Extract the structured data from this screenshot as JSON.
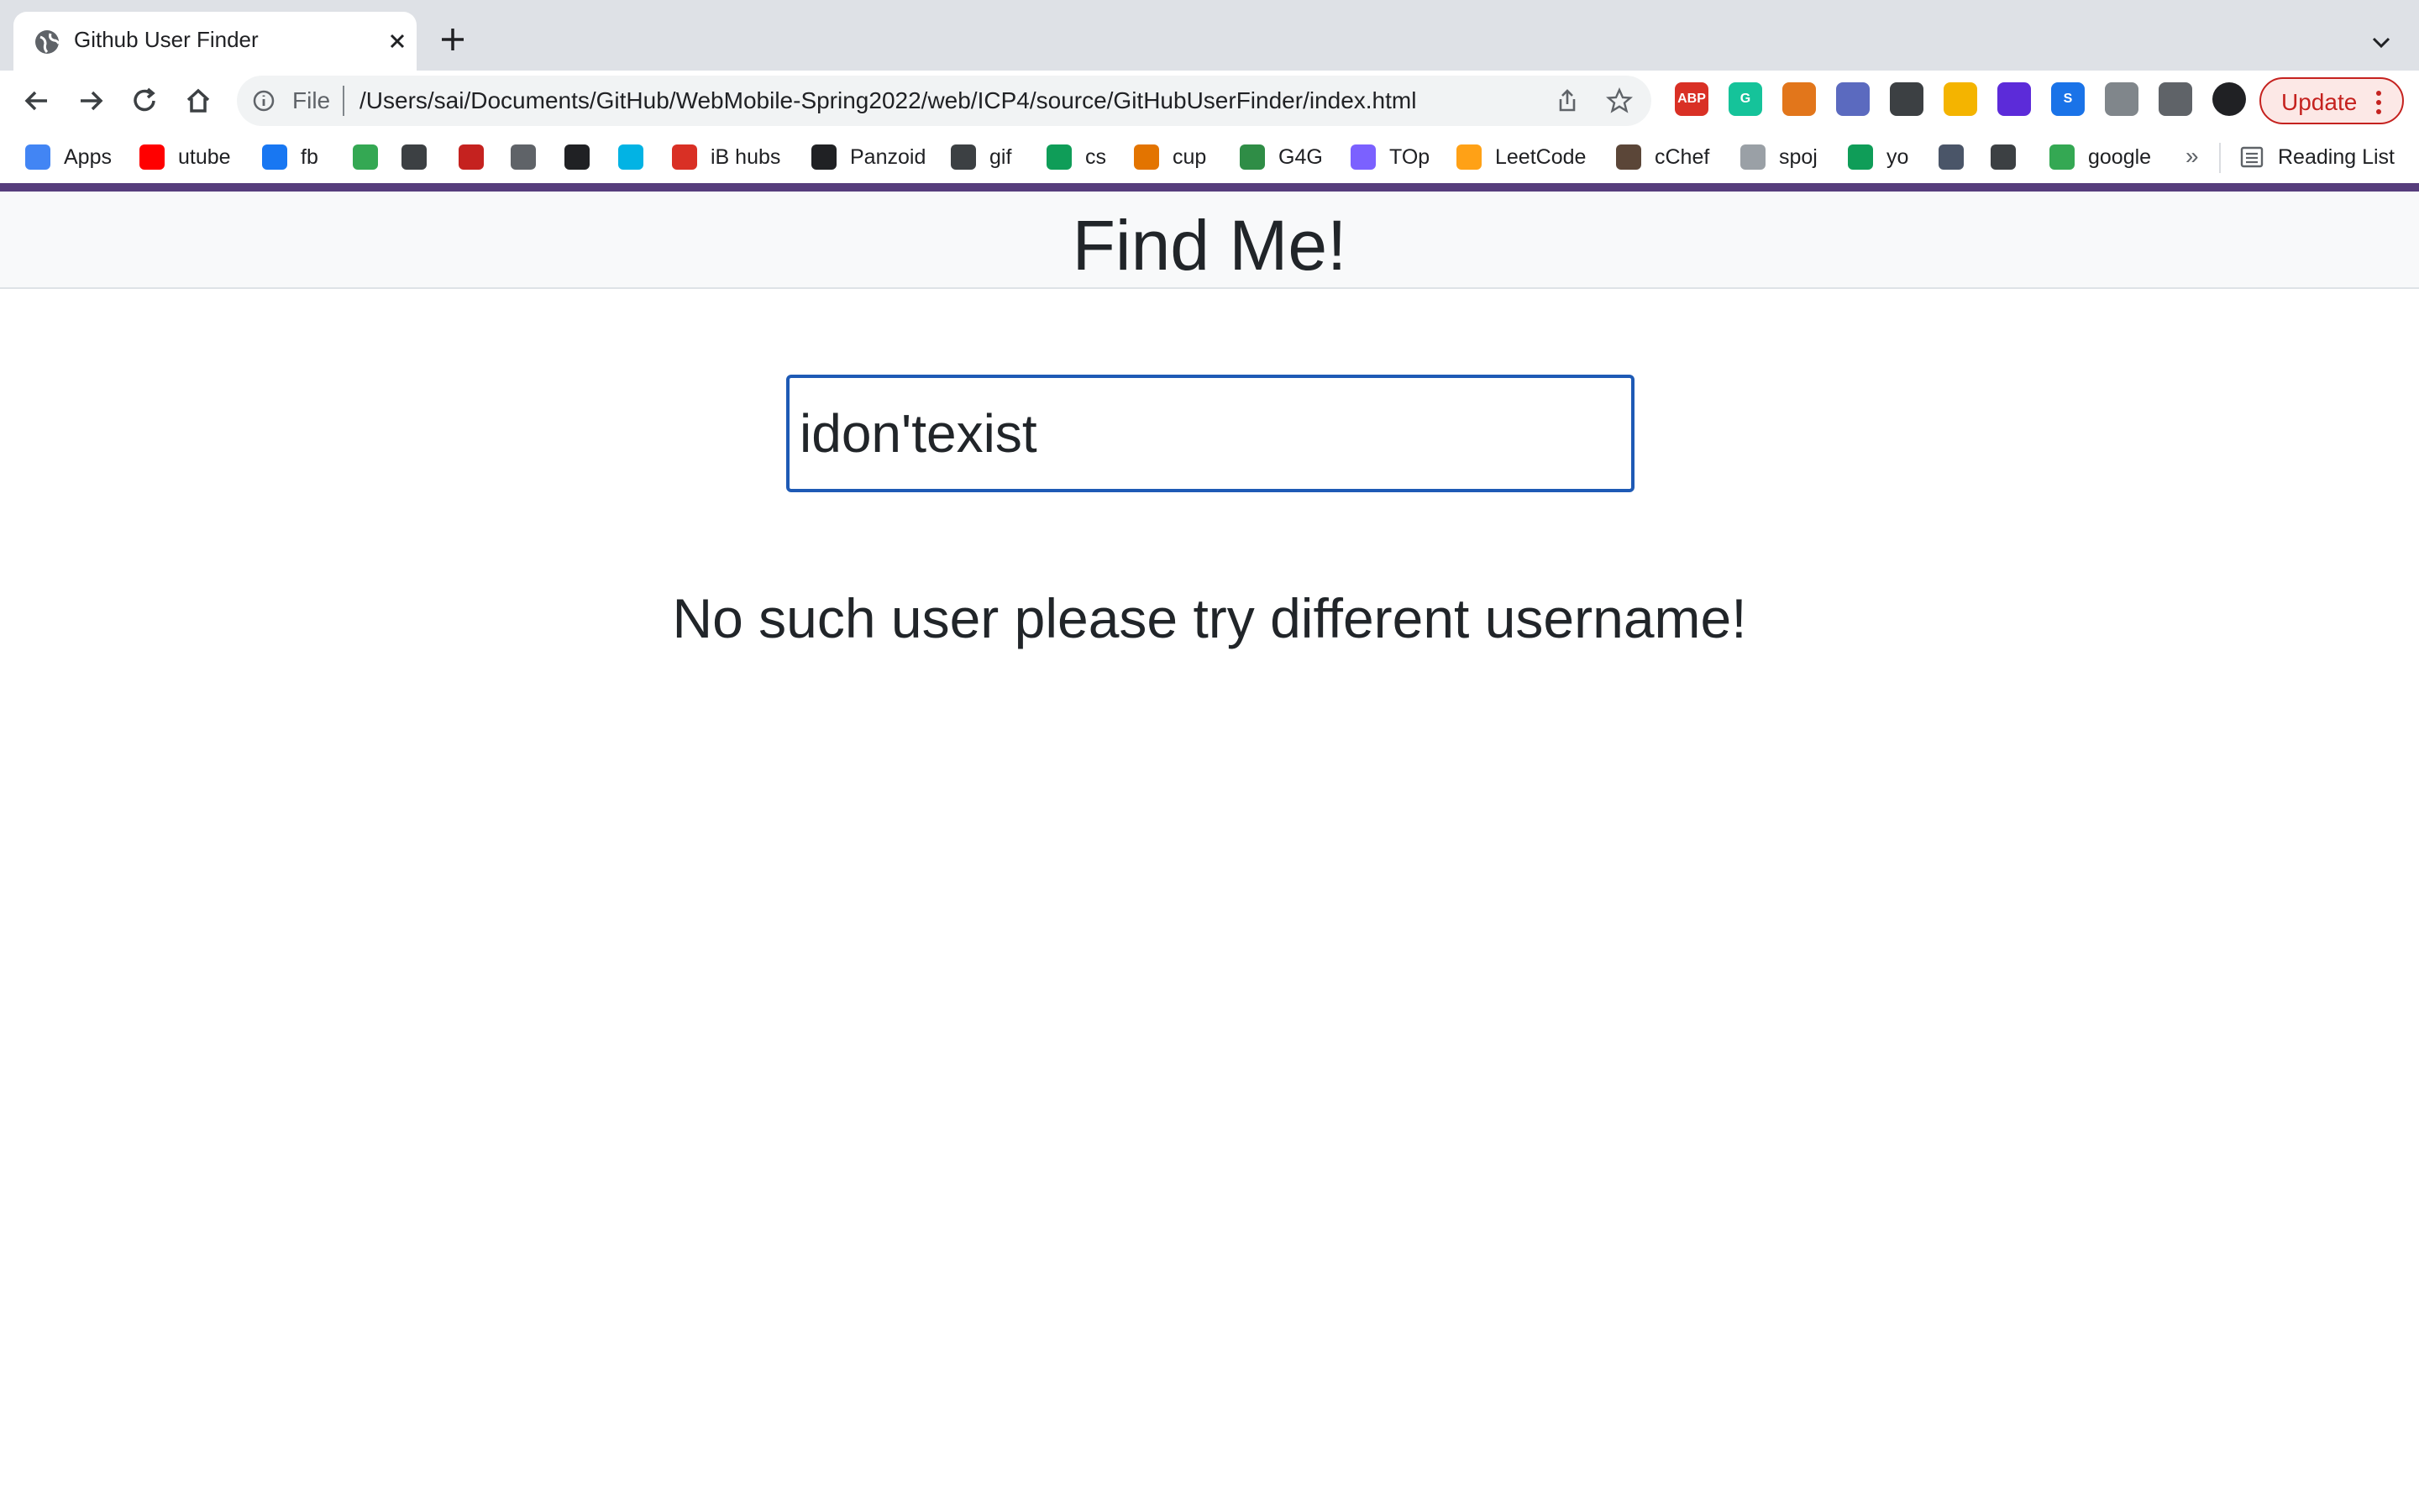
{
  "browser": {
    "tab": {
      "title": "Github User Finder"
    },
    "address": {
      "scheme": "File",
      "url": "/Users/sai/Documents/GitHub/WebMobile-Spring2022/web/ICP4/source/GitHubUserFinder/index.html"
    },
    "update_label": "Update",
    "extensions": [
      {
        "name": "adblock-icon",
        "text": "ABP",
        "color": "#d93025"
      },
      {
        "name": "grammarly-icon",
        "text": "G",
        "color": "#15c39a"
      },
      {
        "name": "metamask-icon",
        "text": "",
        "color": "#e2761b"
      },
      {
        "name": "extension-icon-4",
        "text": "",
        "color": "#5b6abf"
      },
      {
        "name": "qr-icon",
        "text": "",
        "color": "#3c4043"
      },
      {
        "name": "plug-icon",
        "text": "",
        "color": "#f4b400"
      },
      {
        "name": "extension-icon-7",
        "text": "",
        "color": "#5c2bd9"
      },
      {
        "name": "extension-icon-s",
        "text": "S",
        "color": "#1a73e8"
      },
      {
        "name": "shield-icon",
        "text": "",
        "color": "#80868b"
      },
      {
        "name": "puzzle-icon",
        "text": "",
        "color": "#5f6368"
      },
      {
        "name": "profile-avatar",
        "text": "",
        "color": "#202124"
      }
    ]
  },
  "bookmarks": {
    "items": [
      {
        "label": "Apps",
        "color": "#4285f4"
      },
      {
        "label": "utube",
        "color": "#ff0000"
      },
      {
        "label": "fb",
        "color": "#1877f2"
      },
      {
        "label": "",
        "color": "#34a853"
      },
      {
        "label": "",
        "color": "#3c4043"
      },
      {
        "label": "",
        "color": "#c5221f"
      },
      {
        "label": "",
        "color": "#5f6368"
      },
      {
        "label": "",
        "color": "#202124"
      },
      {
        "label": "",
        "color": "#02b3e4"
      },
      {
        "label": "iB hubs",
        "color": "#d93025"
      },
      {
        "label": "Panzoid",
        "color": "#202124"
      },
      {
        "label": "gif",
        "color": "#3c4043"
      },
      {
        "label": "cs",
        "color": "#0f9d58"
      },
      {
        "label": "cup",
        "color": "#e37400"
      },
      {
        "label": "G4G",
        "color": "#2f8d46"
      },
      {
        "label": "TOp",
        "color": "#7b61ff"
      },
      {
        "label": "LeetCode",
        "color": "#ffa116"
      },
      {
        "label": "cChef",
        "color": "#5b4638"
      },
      {
        "label": "spoj",
        "color": "#9aa0a6"
      },
      {
        "label": "yo",
        "color": "#0f9d58"
      },
      {
        "label": "",
        "color": "#4a5568"
      },
      {
        "label": "",
        "color": "#3c4043"
      },
      {
        "label": "google",
        "color": "#34a853"
      }
    ],
    "more": "»",
    "reading_list": "Reading List"
  },
  "page": {
    "title": "Find Me!",
    "search_value": "idon'texist",
    "message": "No such user please try different username!",
    "accent_color": "#563d7c",
    "input_border_color": "#1e5ab5"
  }
}
